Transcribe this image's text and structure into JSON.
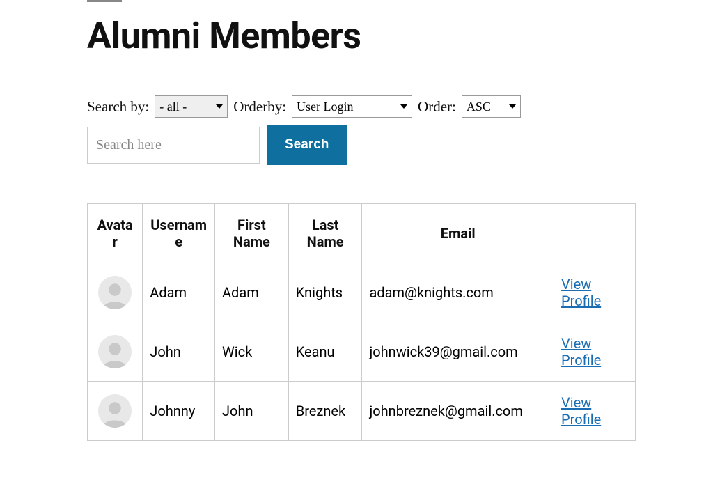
{
  "page": {
    "title": "Alumni Members"
  },
  "filters": {
    "search_by_label": "Search by:",
    "search_by_value": "- all -",
    "orderby_label": "Orderby:",
    "orderby_value": "User Login",
    "order_label": "Order:",
    "order_value": "ASC",
    "search_placeholder": "Search here",
    "search_button": "Search"
  },
  "table": {
    "headers": {
      "avatar": "Avatar",
      "username": "Username",
      "firstname": "First Name",
      "lastname": "Last Name",
      "email": "Email",
      "action": ""
    },
    "rows": [
      {
        "username": "Adam",
        "firstname": "Adam",
        "lastname": "Knights",
        "email": "adam@knights.com",
        "action": "View Profile"
      },
      {
        "username": "John",
        "firstname": "Wick",
        "lastname": "Keanu",
        "email": "johnwick39@gmail.com",
        "action": "View Profile"
      },
      {
        "username": "Johnny",
        "firstname": "John",
        "lastname": "Breznek",
        "email": "johnbreznek@gmail.com",
        "action": "View Profile"
      }
    ]
  }
}
